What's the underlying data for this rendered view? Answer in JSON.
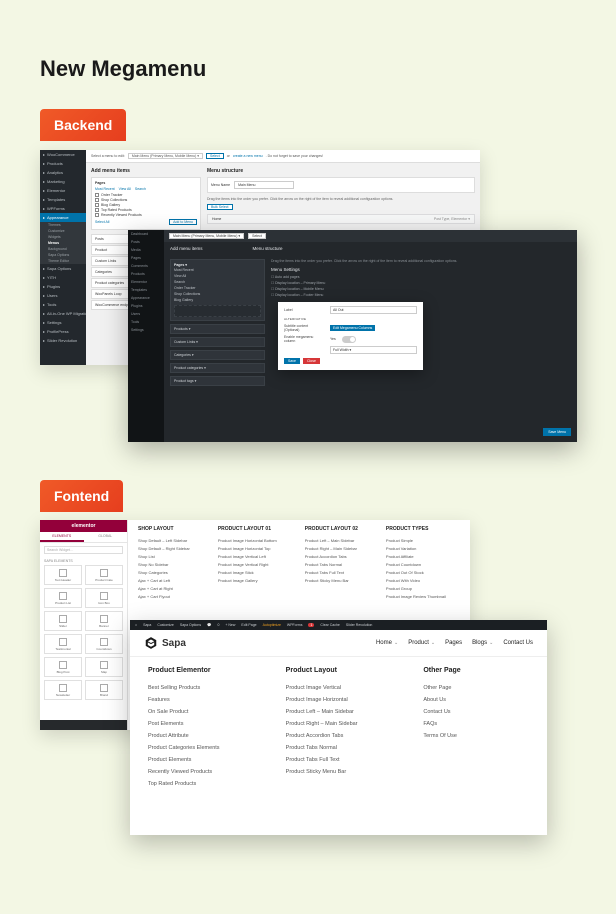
{
  "page": {
    "title": "New Megamenu"
  },
  "badges": {
    "backend": "Backend",
    "frontend": "Fontend"
  },
  "wp_sidebar": [
    {
      "label": "WooCommerce"
    },
    {
      "label": "Products"
    },
    {
      "label": "Analytics"
    },
    {
      "label": "Marketing"
    },
    {
      "label": "Elementor"
    },
    {
      "label": "Templates"
    },
    {
      "label": "WPForms"
    },
    {
      "label": "Appearance",
      "active": true
    }
  ],
  "wp_sidebar_sub": [
    {
      "label": "Themes"
    },
    {
      "label": "Customize"
    },
    {
      "label": "Widgets"
    },
    {
      "label": "Menus",
      "active": true
    },
    {
      "label": "Background"
    },
    {
      "label": "Sapa Options"
    },
    {
      "label": "Theme Editor"
    }
  ],
  "wp_sidebar2": [
    {
      "label": "Sapa Options"
    },
    {
      "label": "YITH"
    },
    {
      "label": "Plugins"
    },
    {
      "label": "Users"
    },
    {
      "label": "Tools"
    },
    {
      "label": "All-in-One WP Migration"
    },
    {
      "label": "Settings"
    },
    {
      "label": "ProfilePress"
    },
    {
      "label": "Slider Revolution"
    }
  ],
  "be1": {
    "topbar_label": "Select a menu to edit:",
    "topbar_select": "Main Menu (Primary Menu, Mobile Menu) ▾",
    "topbar_btn": "Select",
    "topbar_create": "create a new menu",
    "topbar_after": ". Do not forget to save your changes!",
    "left_h": "Add menu items",
    "right_h": "Menu structure",
    "pages_h": "Pages",
    "tabs": [
      "Most Recent",
      "View All",
      "Search"
    ],
    "pages": [
      "Order Tracker",
      "Shop Collections",
      "Blog Gallery",
      "Top Rated Products",
      "Recently Viewed Products"
    ],
    "select_all": "Select All",
    "add_btn": "Add to Menu",
    "left_list": [
      "Posts",
      "Product",
      "Custom Links",
      "Categories",
      "Product categories",
      "WooPanels Loop",
      "WooCommerce endpoints"
    ],
    "menu_name_lbl": "Menu Name",
    "menu_name_val": "Main Menu",
    "struct_desc": "Drag the items into the order you prefer. Click the arrow on the right of the item to reveal additional configuration options.",
    "bulk_select": "Bulk Select",
    "menu_item": "Home",
    "menu_item_type": "Post Type, Elementor ▾"
  },
  "be2": {
    "sidebar": [
      "Dashboard",
      "Posts",
      "Media",
      "Pages",
      "Comments",
      "Products",
      "Elementor",
      "Templates",
      "Appearance",
      "Plugins",
      "Users",
      "Tools",
      "Settings"
    ],
    "top_select": "Main Menu (Primary Menu, Mobile Menu) ▾",
    "top_btn": "Select",
    "header_left": "Add menu items",
    "header_right": "Menu structure",
    "acc_title1": "Pages ▾",
    "acc_rows": [
      "Most Recent",
      "View All",
      "Search",
      "Order Tracker",
      "Shop Collections",
      "Blog Gallery"
    ],
    "acc_others": [
      "Products ▾",
      "Custom Links ▾",
      "Categories ▾",
      "Product categories ▾",
      "Product tags ▾"
    ],
    "right_desc": "Drag the items into the order you prefer. Click the arrow on the right of the item to reveal additional configuration options.",
    "settings_h": "Menu Settings",
    "settings_items": [
      "Auto add pages",
      "Display location – Primary Menu",
      "Display location – Mobile Menu",
      "Display location – Footer Menu"
    ],
    "save": "Save Menu"
  },
  "modal": {
    "rows": [
      {
        "label": "Label",
        "value": "All Out",
        "type": "input"
      },
      {
        "label": "ALTERNATIVE",
        "type": "section"
      },
      {
        "label": "Subtitle content (Optional)",
        "type": "chip",
        "value": "Edit Megamenu Columns"
      },
      {
        "label": "Enable megamenu column",
        "type": "toggle",
        "value": "Yes"
      },
      {
        "label": "",
        "type": "input",
        "value": "Full Width ▾"
      }
    ],
    "save": "Save",
    "close": "Close"
  },
  "elem": {
    "brand": "elementor",
    "tabs": [
      "ELEMENTS",
      "GLOBAL"
    ],
    "search": "Search Widget…",
    "section": "SAPA ELEMENTS",
    "widgets": [
      "Text Header",
      "Product Cate",
      "Product List",
      "Icon Box",
      "Slider",
      "Banner",
      "Testimonial",
      "Countdown",
      "Blog Post",
      "Map",
      "Newsletter",
      "Brand"
    ]
  },
  "fe1_cols": [
    {
      "h": "SHOP LAYOUT",
      "links": [
        "Shop Default – Left Sidebar",
        "Shop Default – Right Sidebar",
        "Shop List",
        "Shop No Sidebar",
        "Shop Categories",
        "Ajax + Cart at Left",
        "Ajax + Cart at Right",
        "Ajax + Cart Flyout"
      ]
    },
    {
      "h": "PRODUCT LAYOUT 01",
      "links": [
        "Product Image Horizontal Bottom",
        "Product Image Horizontal Top",
        "Product Image Vertical Left",
        "Product Image Vertical Right",
        "Product Image Stick",
        "Product Image Gallery"
      ]
    },
    {
      "h": "PRODUCT LAYOUT 02",
      "links": [
        "Product Left – Main Sidebar",
        "Product Right – Main Sidebar",
        "Product Accordion Tabs",
        "Product Tabs Normal",
        "Product Tabs Full Text",
        "Product Sticky Menu Bar"
      ]
    },
    {
      "h": "PRODUCT TYPES",
      "links": [
        "Product Simple",
        "Product Variation",
        "Product Affiliate",
        "Product Countdown",
        "Product Out Of Stock",
        "Product With Video",
        "Product Group",
        "Product Image Review Thumbnail"
      ]
    }
  ],
  "fe2_adminbar": [
    "Sapa",
    "Customize",
    "Sapa Options",
    "0",
    "+ New",
    "Edit Page",
    "Autoptimize",
    "WPForms",
    "1",
    "Clear Cache",
    "Slider Revolution"
  ],
  "fe2_brand": "Sapa",
  "fe2_navlinks": [
    {
      "label": "Home",
      "caret": true
    },
    {
      "label": "Product",
      "caret": true
    },
    {
      "label": "Pages",
      "caret": false
    },
    {
      "label": "Blogs",
      "caret": true
    },
    {
      "label": "Contact Us",
      "caret": false
    }
  ],
  "fe2_cols": [
    {
      "h": "Product Elementor",
      "links": [
        "Best Selling Products",
        "Features",
        "On Sale Product",
        "Post Elements",
        "Product Attribute",
        "Product Categories Elements",
        "Product Elements",
        "Recently Viewed Products",
        "Top Rated Products"
      ]
    },
    {
      "h": "Product Layout",
      "links": [
        "Product Image Vertical",
        "Product Image Horizontal",
        "Product Left – Main Sidebar",
        "Product Right – Main Sidebar",
        "Product Accordion Tabs",
        "Product Tabs Normal",
        "Product Tabs Full Text",
        "Product Sticky Menu Bar"
      ]
    },
    {
      "h": "Other Page",
      "links": [
        "Other Page",
        "About Us",
        "Contact Us",
        "FAQs",
        "Terms Of Use"
      ]
    }
  ]
}
